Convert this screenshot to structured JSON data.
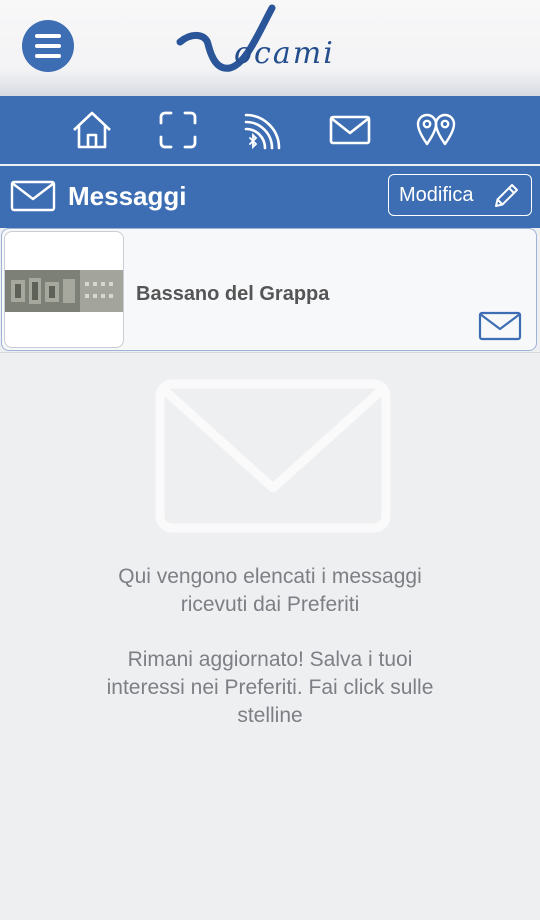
{
  "header": {
    "logo_text": "ocami",
    "menu_icon": "hamburger-icon"
  },
  "nav": {
    "items": [
      {
        "name": "home",
        "icon": "home-icon"
      },
      {
        "name": "scan",
        "icon": "scan-icon"
      },
      {
        "name": "bluetooth-beacon",
        "icon": "bluetooth-signal-icon"
      },
      {
        "name": "messages",
        "icon": "mail-icon"
      },
      {
        "name": "places",
        "icon": "map-pins-icon"
      }
    ]
  },
  "messages_bar": {
    "title": "Messaggi",
    "edit_label": "Modifica",
    "title_icon": "mail-icon",
    "edit_icon": "pencil-icon"
  },
  "messages": [
    {
      "title": "Bassano del Grappa",
      "thumbnail": "stone-relief-image",
      "icon": "mail-icon"
    }
  ],
  "empty_state": {
    "line1a": "Qui vengono elencati i messaggi",
    "line1b": "ricevuti dai Preferiti",
    "line2a": "Rimani aggiornato! Salva i tuoi",
    "line2b": "interessi nei Preferiti. Fai click sulle",
    "line2c": "stelline"
  },
  "colors": {
    "brand_blue": "#3d6db2",
    "background": "#eeeff1"
  }
}
